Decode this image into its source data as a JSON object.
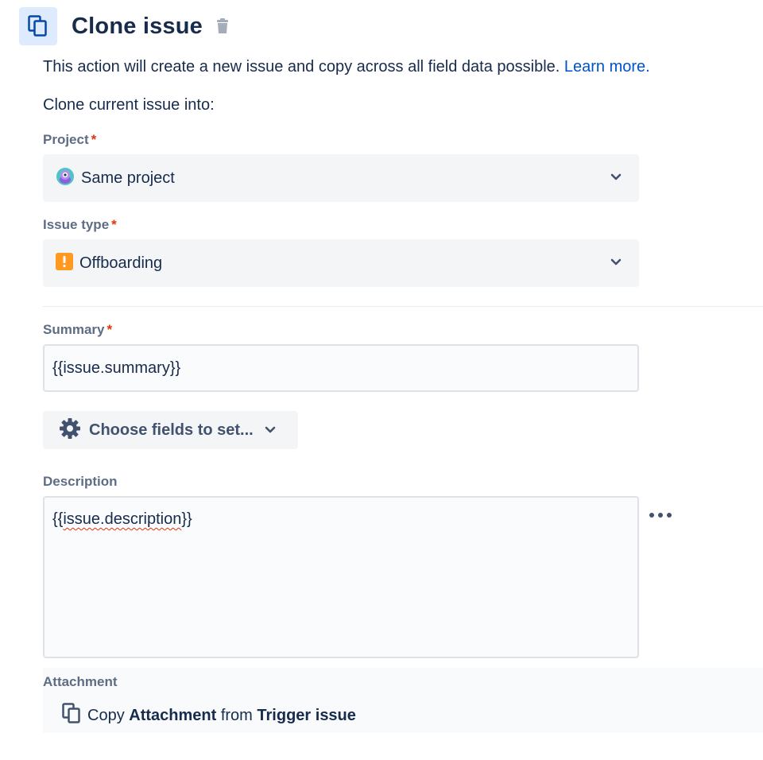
{
  "header": {
    "title": "Clone issue",
    "icon": "copy-icon",
    "delete_icon": "trash-icon"
  },
  "intro": {
    "text": "This action will create a new issue and copy across all field data possible.",
    "link": "Learn more."
  },
  "clone_into": "Clone current issue into:",
  "project": {
    "label": "Project",
    "required": "*",
    "value": "Same project",
    "icon": "project-avatar-icon"
  },
  "issue_type": {
    "label": "Issue type",
    "required": "*",
    "value": "Offboarding",
    "icon": "offboarding-type-icon",
    "icon_color": "#ff991f"
  },
  "summary": {
    "label": "Summary",
    "required": "*",
    "value": "{{issue.summary}}"
  },
  "choose_fields": {
    "label": "Choose fields to set...",
    "icon": "gear-icon"
  },
  "description": {
    "label": "Description",
    "value_prefix": "{{",
    "value_word": "issue.description",
    "value_suffix": "}}"
  },
  "attachment": {
    "label": "Attachment",
    "text_copy": "Copy",
    "text_field": "Attachment",
    "text_from": "from",
    "text_source": "Trigger issue",
    "icon": "copy-icon"
  },
  "colors": {
    "accent": "#0052cc",
    "required": "#de350b",
    "text": "#172b4d",
    "label": "#5e6c84",
    "field_bg": "#f4f5f7"
  }
}
